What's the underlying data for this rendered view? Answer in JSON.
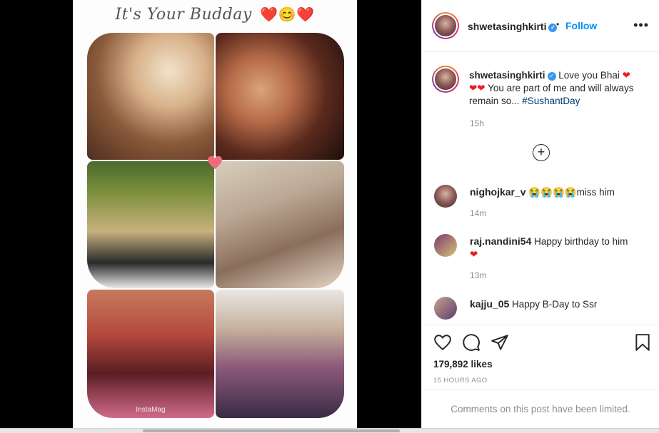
{
  "media": {
    "title_text": "It's Your Budday",
    "title_emojis": "❤️😊❤️",
    "watermark": "InstaMag",
    "photos": [
      "p1",
      "p2",
      "p3",
      "p4",
      "p5",
      "p6"
    ]
  },
  "header": {
    "username": "shwetasinghkirti",
    "separator": "•",
    "follow_label": "Follow",
    "more_label": "•••"
  },
  "caption": {
    "username": "shwetasinghkirti",
    "text_before": " Love you Bhai ",
    "hearts_1": "❤",
    "hearts_2": "❤❤",
    "text_after": " You are part of me and will always remain so... ",
    "hashtag": "#SushantDay",
    "time": "15h"
  },
  "load_more_label": "+",
  "comments": [
    {
      "username": "nighojkar_v",
      "text": " 😭😭😭😭miss him",
      "time": "14m"
    },
    {
      "username": "raj.nandini54",
      "text": " Happy birthday to him ",
      "heart": "❤",
      "time": "13m"
    },
    {
      "username": "kajju_05",
      "text": " Happy B-Day to Ssr",
      "time": ""
    }
  ],
  "actions": {
    "likes": "179,892 likes",
    "posted_ago": "15 HOURS AGO"
  },
  "footer": {
    "limited_text": "Comments on this post have been limited."
  },
  "colors": {
    "accent": "#0095f6",
    "heart": "#ed1c24",
    "hashtag": "#00376b",
    "muted": "#8e8e8e"
  }
}
